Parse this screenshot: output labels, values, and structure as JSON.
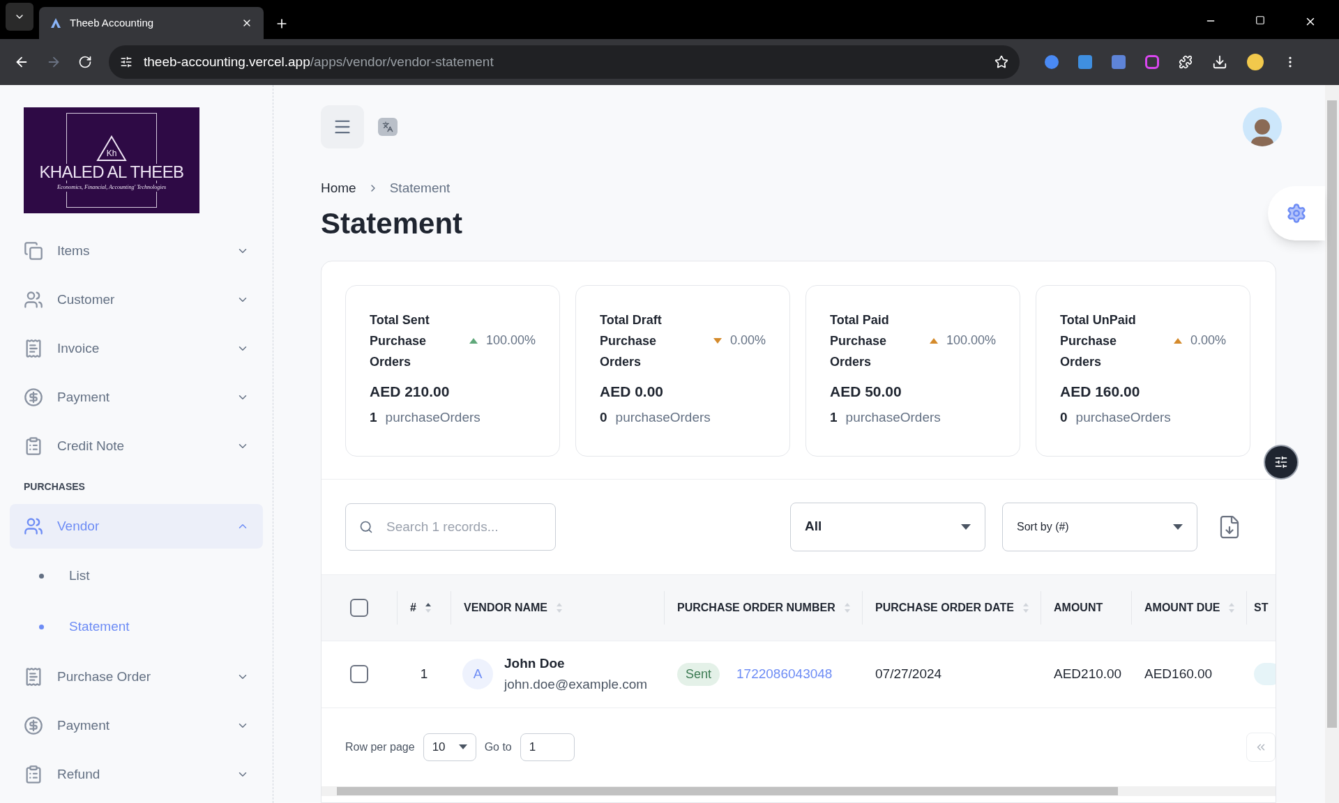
{
  "browser": {
    "tab_title": "Theeb Accounting",
    "url_host": "theeb-accounting.vercel.app",
    "url_path": "/apps/vendor/vendor-statement"
  },
  "logo": {
    "mark": "Kh",
    "name": "KHALED AL THEEB",
    "tagline": "Economics, Financial, Accounting' Technologies"
  },
  "sidebar": {
    "groups": [
      {
        "items": [
          {
            "label": "Items",
            "expanded": false,
            "selected": false
          },
          {
            "label": "Customer",
            "expanded": false,
            "selected": false
          },
          {
            "label": "Invoice",
            "expanded": false,
            "selected": false
          },
          {
            "label": "Payment",
            "expanded": false,
            "selected": false
          },
          {
            "label": "Credit Note",
            "expanded": false,
            "selected": false
          }
        ]
      },
      {
        "heading": "PURCHASES",
        "items": [
          {
            "label": "Vendor",
            "expanded": true,
            "selected": true,
            "children": [
              {
                "label": "List",
                "selected": false
              },
              {
                "label": "Statement",
                "selected": true
              }
            ]
          },
          {
            "label": "Purchase Order",
            "expanded": false,
            "selected": false
          },
          {
            "label": "Payment",
            "expanded": false,
            "selected": false
          },
          {
            "label": "Refund",
            "expanded": false,
            "selected": false
          }
        ]
      }
    ]
  },
  "breadcrumb": [
    "Home",
    "Statement"
  ],
  "page_title": "Statement",
  "stats": [
    {
      "title": "Total Sent Purchase Orders",
      "kind": "up",
      "color": "#5fa87a",
      "change": "100.00%",
      "amount": "AED 210.00",
      "count": "1",
      "count_label": "purchaseOrders"
    },
    {
      "title": "Total Draft Purchase Orders",
      "kind": "down",
      "color": "#d48a2b",
      "change": "0.00%",
      "amount": "AED 0.00",
      "count": "0",
      "count_label": "purchaseOrders"
    },
    {
      "title": "Total Paid Purchase Orders",
      "kind": "up",
      "color": "#d48a2b",
      "change": "100.00%",
      "amount": "AED 50.00",
      "count": "1",
      "count_label": "purchaseOrders"
    },
    {
      "title": "Total UnPaid Purchase Orders",
      "kind": "up",
      "color": "#d48a2b",
      "change": "0.00%",
      "amount": "AED 160.00",
      "count": "0",
      "count_label": "purchaseOrders"
    }
  ],
  "filters": {
    "search_placeholder": "Search 1 records...",
    "status": "All",
    "sort": "Sort by (#)"
  },
  "table": {
    "all_checked": false,
    "columns": [
      {
        "label": "#",
        "kind": "sorted"
      },
      {
        "label": "VENDOR NAME",
        "kind": "sortable"
      },
      {
        "label": "PURCHASE ORDER NUMBER",
        "kind": "sortable"
      },
      {
        "label": "PURCHASE ORDER DATE",
        "kind": "sortable"
      },
      {
        "label": "AMOUNT",
        "kind": "plain"
      },
      {
        "label": "AMOUNT DUE",
        "kind": "sortable"
      },
      {
        "label": "ST",
        "kind": "plain"
      }
    ],
    "rows": [
      {
        "checked": false,
        "number": "1",
        "avatar": "A",
        "name": "John Doe",
        "email": "john.doe@example.com",
        "status": "Sent",
        "po_number": "1722086043048",
        "date": "07/27/2024",
        "amount": "AED210.00",
        "amount_due": "AED160.00"
      }
    ]
  },
  "pagination": {
    "rows_label": "Row per page",
    "rows_value": "10",
    "goto_label": "Go to",
    "goto_value": "1"
  }
}
